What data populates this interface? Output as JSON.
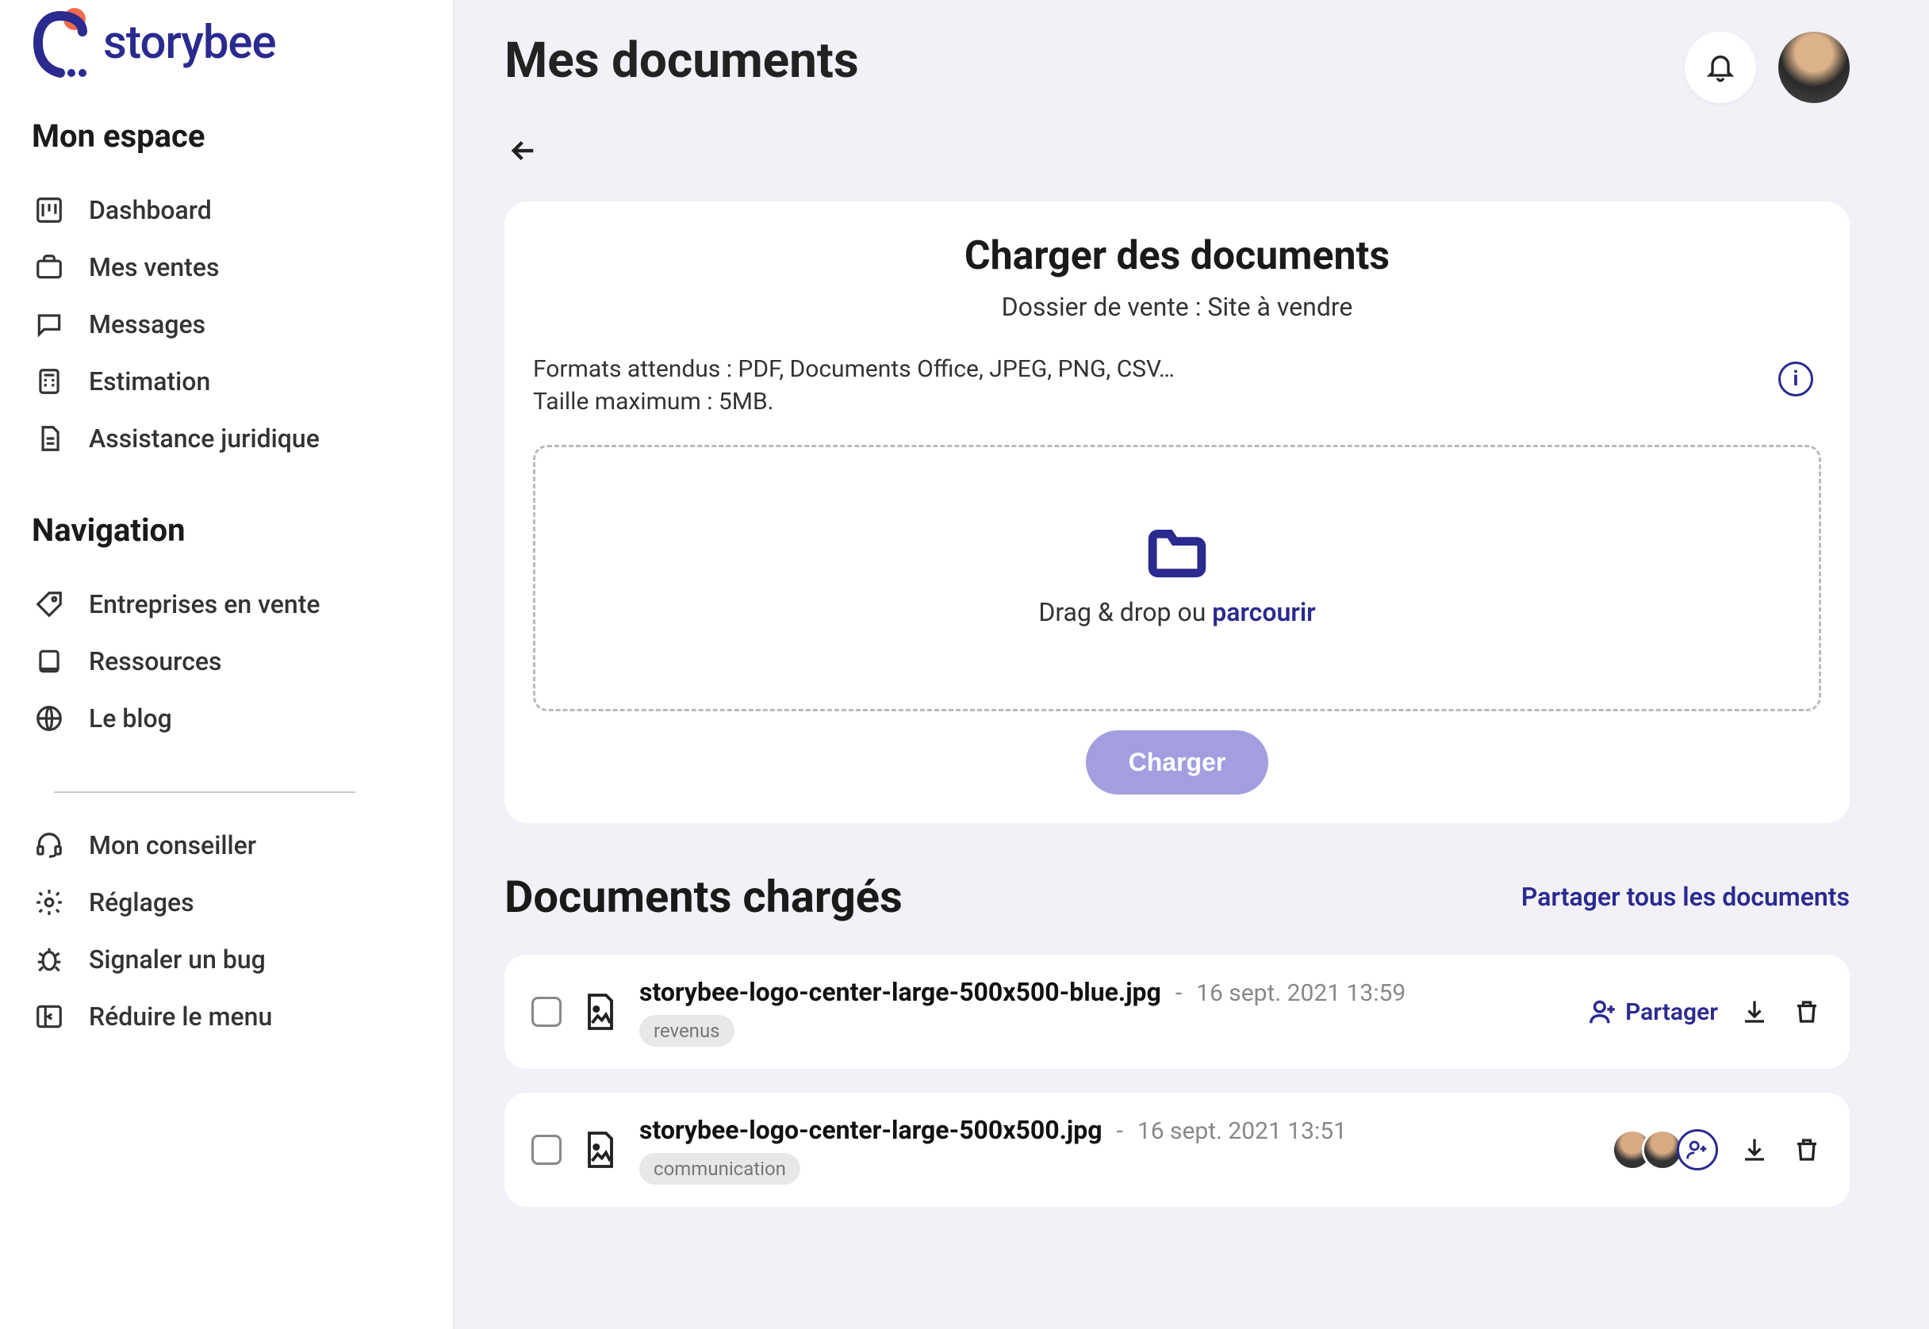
{
  "brand": {
    "name": "storybee"
  },
  "sidebar": {
    "section1_title": "Mon espace",
    "items1": [
      {
        "label": "Dashboard",
        "icon": "dashboard"
      },
      {
        "label": "Mes ventes",
        "icon": "briefcase"
      },
      {
        "label": "Messages",
        "icon": "message"
      },
      {
        "label": "Estimation",
        "icon": "calculator"
      },
      {
        "label": "Assistance juridique",
        "icon": "document"
      }
    ],
    "section2_title": "Navigation",
    "items2": [
      {
        "label": "Entreprises en vente",
        "icon": "tag"
      },
      {
        "label": "Ressources",
        "icon": "book"
      },
      {
        "label": "Le blog",
        "icon": "globe"
      }
    ],
    "items3": [
      {
        "label": "Mon conseiller",
        "icon": "headset"
      },
      {
        "label": "Réglages",
        "icon": "gear"
      },
      {
        "label": "Signaler un bug",
        "icon": "bug"
      },
      {
        "label": "Réduire le menu",
        "icon": "collapse"
      }
    ]
  },
  "header": {
    "title": "Mes documents"
  },
  "upload": {
    "title": "Charger des documents",
    "subtitle": "Dossier de vente : Site à vendre",
    "hint_formats": "Formats attendus : PDF, Documents Office, JPEG, PNG, CSV…",
    "hint_size": "Taille maximum : 5MB.",
    "dropzone_prefix": "Drag & drop ou ",
    "dropzone_browse": "parcourir",
    "button": "Charger"
  },
  "loaded": {
    "title": "Documents chargés",
    "share_all": "Partager tous les documents",
    "share_label": "Partager",
    "rows": [
      {
        "name": "storybee-logo-center-large-500x500-blue.jpg",
        "date": "16 sept. 2021 13:59",
        "tag": "revenus",
        "shared_with": 0
      },
      {
        "name": "storybee-logo-center-large-500x500.jpg",
        "date": "16 sept. 2021 13:51",
        "tag": "communication",
        "shared_with": 2
      }
    ]
  }
}
